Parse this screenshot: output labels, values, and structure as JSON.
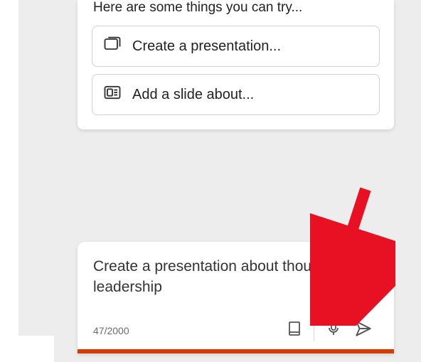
{
  "suggestions": {
    "intro": "Here are some things you can try...",
    "items": [
      {
        "label": "Create a presentation..."
      },
      {
        "label": "Add a slide about..."
      }
    ]
  },
  "composer": {
    "text": "Create a presentation about thought leadership",
    "counter": "47/2000"
  },
  "colors": {
    "accent": "#d83b01",
    "annotation_arrow": "#e81123"
  }
}
